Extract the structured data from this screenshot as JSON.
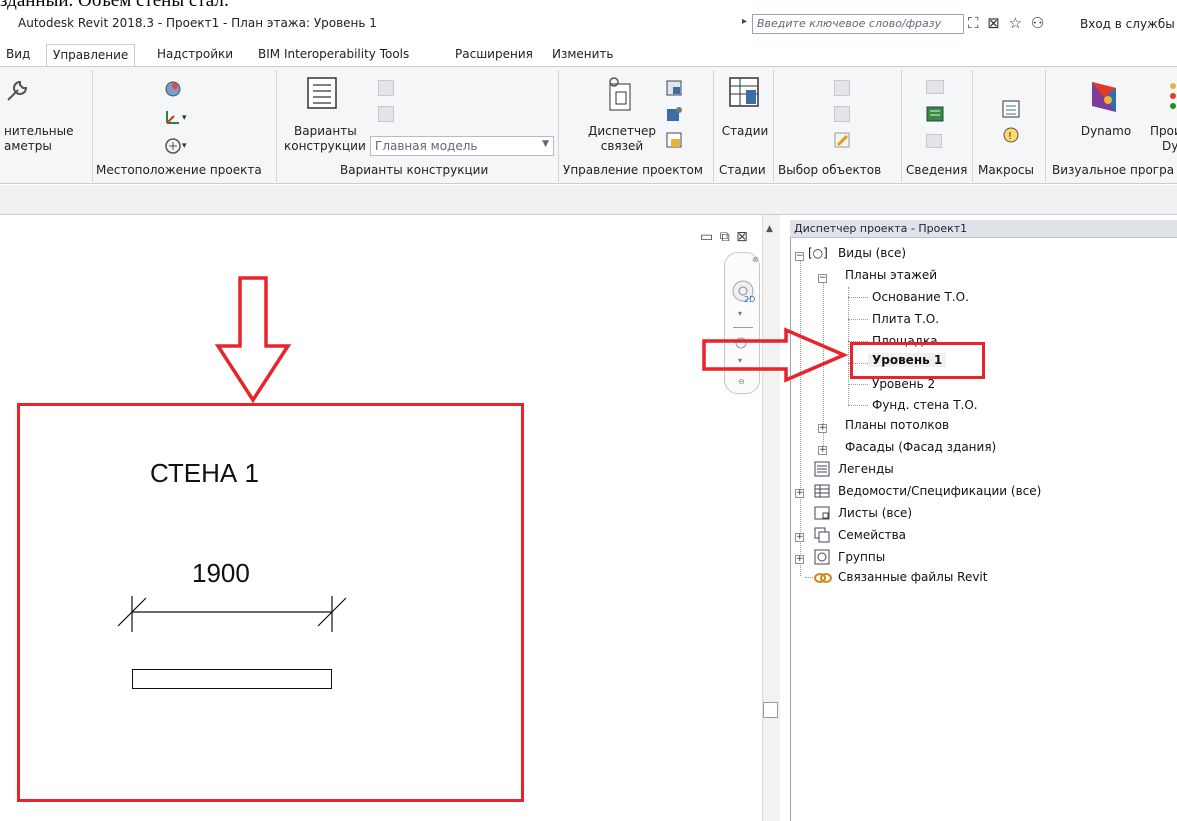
{
  "doc_text": "зданный. Объем стены стал:",
  "window": {
    "title": "Autodesk Revit 2018.3 -    Проект1 - План этажа: Уровень 1",
    "search_placeholder": "Введите ключевое слово/фразу",
    "signin_label": "Вход в службы"
  },
  "tabs": [
    "Вид",
    "Управление",
    "Надстройки",
    "BIM Interoperability Tools",
    "Расширения",
    "Изменить"
  ],
  "active_tab": "Управление",
  "ribbon": {
    "params_label_1": "нительные",
    "params_label_2": "аметры",
    "design_options_label_1": "Варианты",
    "design_options_label_2": "конструкции",
    "design_option_select": "Главная модель",
    "manage_links_label_1": "Диспетчер",
    "manage_links_label_2": "связей",
    "phases_label": "Стадии",
    "dynamo_label": "Dynamo",
    "dynamo_player_label_1": "Прои",
    "dynamo_player_label_2": "Dy",
    "panels": {
      "location": "Местоположение проекта",
      "design_options": "Варианты конструкции",
      "project_manage": "Управление проектом",
      "phases": "Стадии",
      "selection": "Выбор объектов",
      "info": "Сведения",
      "macros": "Макросы",
      "visual_prog": "Визуальное програ"
    }
  },
  "canvas": {
    "wall_name": "СТЕНА 1",
    "dimension": "1900"
  },
  "project_browser": {
    "title": "Диспетчер проекта - Проект1",
    "views_root": "Виды (все)",
    "floor_plans": "Планы этажей",
    "plans": [
      "Основание Т.О.",
      "Плита Т.О.",
      "Площадка",
      "Уровень 1",
      "Уровень 2",
      "Фунд. стена Т.О."
    ],
    "ceiling_plans": "Планы потолков",
    "elevations": "Фасады (Фасад здания)",
    "legends": "Легенды",
    "schedules": "Ведомости/Спецификации (все)",
    "sheets": "Листы (все)",
    "families": "Семейства",
    "groups": "Группы",
    "revit_links": "Связанные файлы Revit"
  },
  "colors": {
    "annotation_red": "#e8232a",
    "ribbon_bg": "#f5f6f7"
  }
}
